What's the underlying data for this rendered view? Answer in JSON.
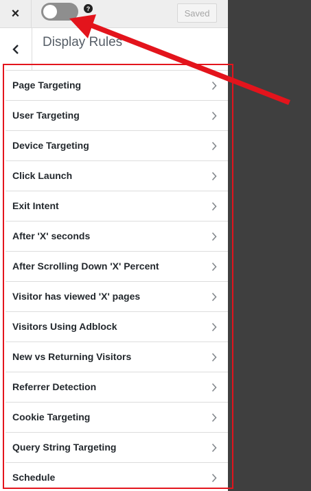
{
  "header": {
    "close_label": "×",
    "help_label": "?",
    "saved_label": "Saved",
    "toggle_on": false
  },
  "section": {
    "title": "Display Rules",
    "back_icon": "chevron-left-icon"
  },
  "rules": [
    {
      "label": "Page Targeting"
    },
    {
      "label": "User Targeting"
    },
    {
      "label": "Device Targeting"
    },
    {
      "label": "Click Launch"
    },
    {
      "label": "Exit Intent"
    },
    {
      "label": "After 'X' seconds"
    },
    {
      "label": "After Scrolling Down 'X' Percent"
    },
    {
      "label": "Visitor has viewed 'X' pages"
    },
    {
      "label": "Visitors Using Adblock"
    },
    {
      "label": "New vs Returning Visitors"
    },
    {
      "label": "Referrer Detection"
    },
    {
      "label": "Cookie Targeting"
    },
    {
      "label": "Query String Targeting"
    },
    {
      "label": "Schedule"
    }
  ],
  "colors": {
    "annotation": "#e3141c",
    "backdrop": "#3f3f3f"
  }
}
